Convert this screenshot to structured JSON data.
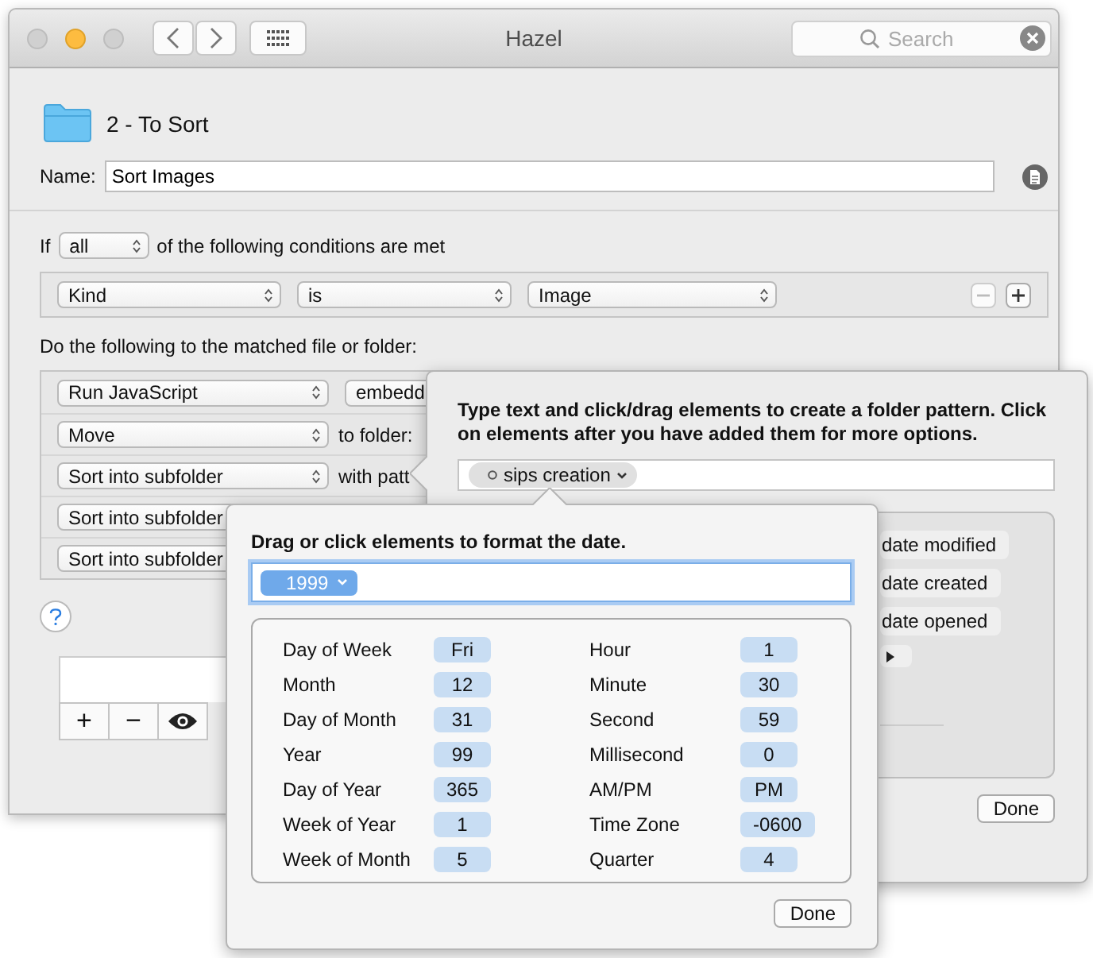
{
  "window": {
    "title": "Hazel",
    "traffic_lights": [
      {
        "on": false
      },
      {
        "on": true
      },
      {
        "on": false
      }
    ]
  },
  "search": {
    "placeholder": "Search"
  },
  "folder": {
    "name": "2 - To Sort"
  },
  "rule_name": {
    "label": "Name:",
    "value": "Sort Images"
  },
  "conditions": {
    "prefix": "If",
    "match": "all",
    "suffix": "of the following conditions are met",
    "rows": [
      {
        "fields": [
          "Kind",
          "is",
          "Image"
        ]
      }
    ]
  },
  "actions": {
    "heading": "Do the following to the matched file or folder:",
    "rows": [
      {
        "action": "Run JavaScript",
        "detail": {
          "kind": "popup",
          "text": "embedd"
        }
      },
      {
        "action": "Move",
        "detail": {
          "kind": "label",
          "text": "to folder:"
        }
      },
      {
        "action": "Sort into subfolder",
        "detail": {
          "kind": "label",
          "text": "with patt"
        }
      },
      {
        "action": "Sort into subfolder"
      },
      {
        "action": "Sort into subfolder"
      }
    ]
  },
  "list_toolbar": [
    "+",
    "−"
  ],
  "pattern_popover": {
    "instructions": "Type text and click/drag elements to create a folder pattern. Click on elements after you have added them for more options.",
    "tokens": [
      "sips creation"
    ],
    "elements": [
      "date modified",
      "date created",
      "date opened"
    ],
    "done": "Done"
  },
  "date_popover": {
    "title": "Drag or click elements to format the date.",
    "tokens": [
      "1999"
    ],
    "columns": [
      [
        {
          "label": "Day of Week",
          "value": "Fri"
        },
        {
          "label": "Month",
          "value": "12"
        },
        {
          "label": "Day of Month",
          "value": "31"
        },
        {
          "label": "Year",
          "value": "99"
        },
        {
          "label": "Day of Year",
          "value": "365"
        },
        {
          "label": "Week of Year",
          "value": "1"
        },
        {
          "label": "Week of Month",
          "value": "5"
        }
      ],
      [
        {
          "label": "Hour",
          "value": "1"
        },
        {
          "label": "Minute",
          "value": "30"
        },
        {
          "label": "Second",
          "value": "59"
        },
        {
          "label": "Millisecond",
          "value": "0"
        },
        {
          "label": "AM/PM",
          "value": "PM"
        },
        {
          "label": "Time Zone",
          "value": "-0600"
        },
        {
          "label": "Quarter",
          "value": "4"
        }
      ]
    ],
    "done": "Done"
  }
}
